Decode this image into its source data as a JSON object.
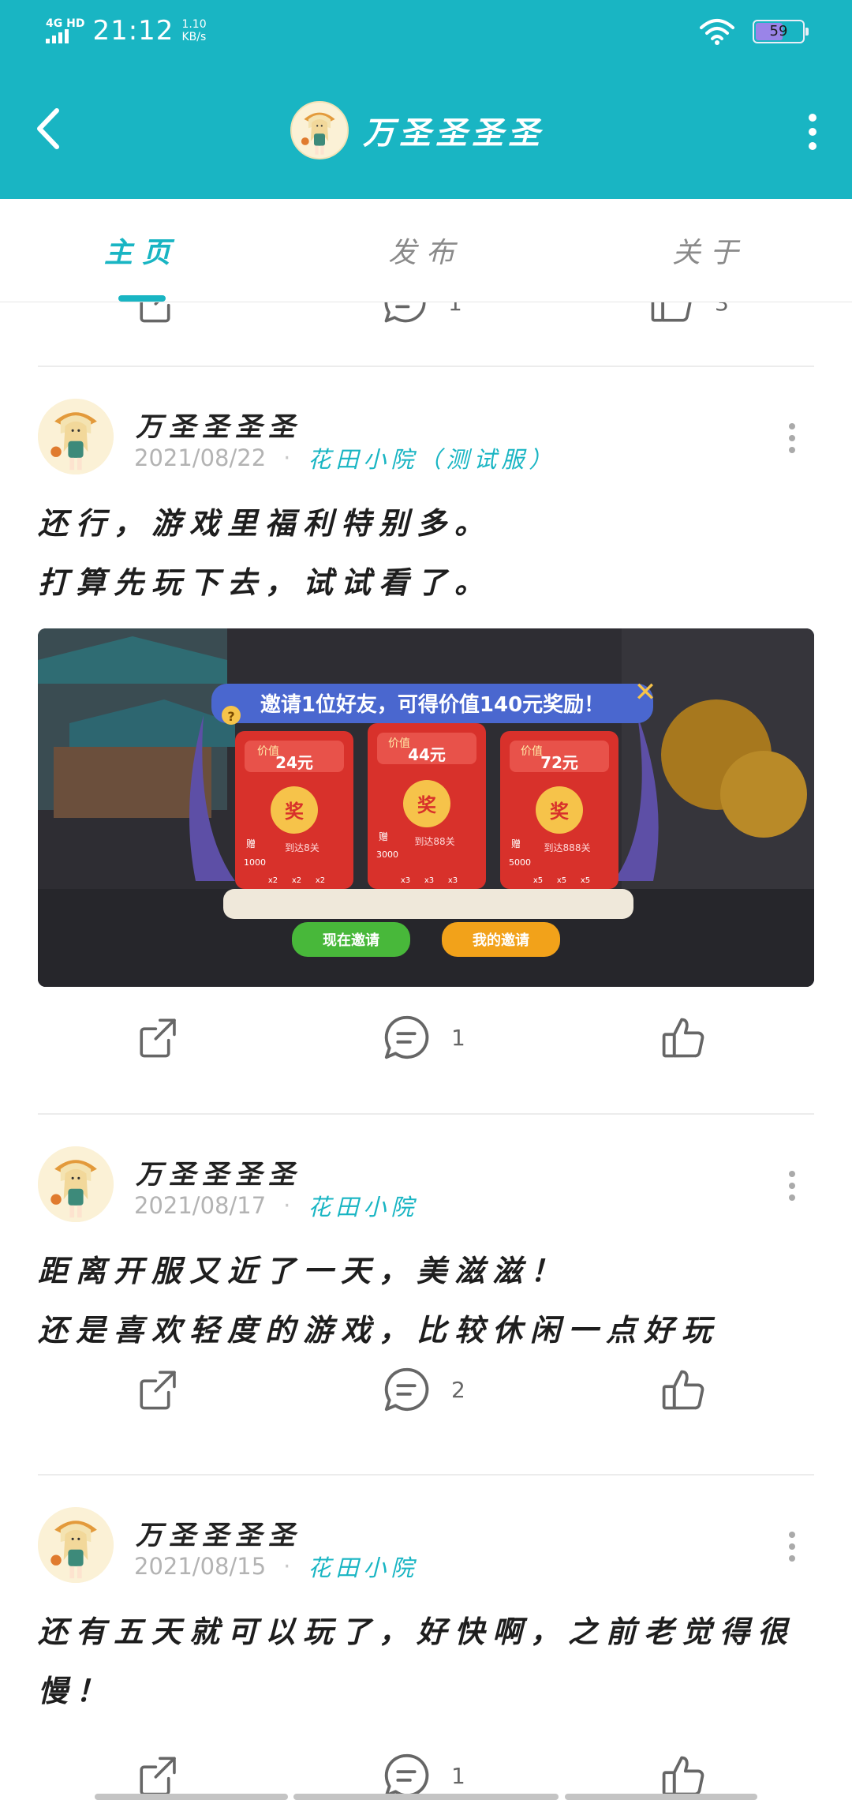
{
  "status_bar": {
    "network": "4G HD",
    "time": "21:12",
    "speed_value": "1.10",
    "speed_unit": "KB/s",
    "battery_level": "59",
    "icons": [
      "signal-icon",
      "wifi-icon",
      "battery-icon"
    ]
  },
  "app_bar": {
    "title": "万圣圣圣圣",
    "icons": [
      "back-arrow-icon",
      "more-vertical-icon"
    ]
  },
  "tabs": [
    {
      "label": "主页",
      "active": true
    },
    {
      "label": "发布",
      "active": false
    },
    {
      "label": "关于",
      "active": false
    }
  ],
  "colors": {
    "brand": "#19b5c3",
    "text": "#1e1e1e",
    "meta": "#b3b3b3",
    "divider": "#ececec"
  },
  "posts": [
    {
      "author": "万圣圣圣圣",
      "date": "2021/08/22",
      "separator": "·",
      "game": "花田小院（测试服）",
      "lines": [
        "还行，游戏里福利特别多。",
        "打算先玩下去，试试看了。"
      ],
      "image": {
        "banner": "邀请1位好友，可得价值140元奖励！",
        "cards": [
          {
            "tag": "价值",
            "amount": "24元",
            "prize": "奖",
            "gift": "1000",
            "requirement": "到达8关",
            "counts": [
              "x2",
              "x2",
              "x2"
            ]
          },
          {
            "tag": "价值",
            "amount": "44元",
            "prize": "奖",
            "gift": "3000",
            "requirement": "到达88关",
            "counts": [
              "x3",
              "x3",
              "x3"
            ]
          },
          {
            "tag": "价值",
            "amount": "72元",
            "prize": "奖",
            "gift": "5000",
            "requirement": "到达888关",
            "counts": [
              "x5",
              "x5",
              "x5"
            ]
          }
        ],
        "gift_label": "赠",
        "help_symbol": "?",
        "invite_now": "现在邀请",
        "my_invites": "我的邀请",
        "close_symbol": "✕"
      },
      "comment_count": "1"
    },
    {
      "author": "万圣圣圣圣",
      "date": "2021/08/17",
      "separator": "·",
      "game": "花田小院",
      "lines": [
        "距离开服又近了一天，美滋滋！",
        "还是喜欢轻度的游戏，比较休闲一点好玩"
      ],
      "comment_count": "2"
    },
    {
      "author": "万圣圣圣圣",
      "date": "2021/08/15",
      "separator": "·",
      "game": "花田小院",
      "lines": [
        "还有五天就可以玩了，好快啊，之前老觉得很",
        "慢！"
      ],
      "comment_count": "1"
    }
  ],
  "previous_post": {
    "comment_count": "1",
    "like_count": "3"
  }
}
